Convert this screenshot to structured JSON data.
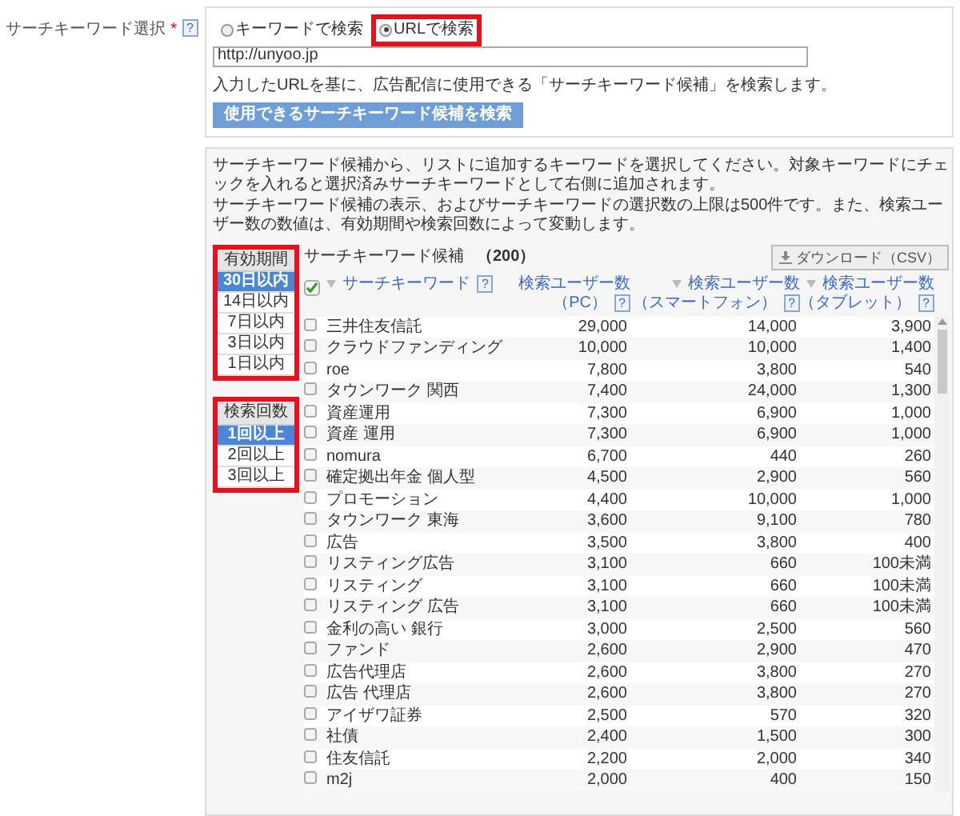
{
  "field": {
    "label": "サーチキーワード選択",
    "required": "*",
    "help": "?"
  },
  "search": {
    "modes": [
      {
        "label": "キーワードで検索",
        "selected": false,
        "highlighted": false
      },
      {
        "label": "URLで検索",
        "selected": true,
        "highlighted": true
      }
    ],
    "value": "http://unyoo.jp",
    "description": "入力したURLを基に、広告配信に使用できる「サーチキーワード候補」を検索します。",
    "button": "使用できるサーチキーワード候補を検索"
  },
  "instructions": [
    "サーチキーワード候補から、リストに追加するキーワードを選択してください。対象キーワードにチェックを入れると選択済みサーチキーワードとして右側に追加されます。",
    "サーチキーワード候補の表示、およびサーチキーワードの選択数の上限は500件です。また、検索ユーザー数の数値は、有効期間や検索回数によって変動します。"
  ],
  "filters": [
    {
      "title": "有効期間",
      "highlighted": true,
      "options": [
        {
          "label": "30日以内",
          "selected": true
        },
        {
          "label": "14日以内",
          "selected": false
        },
        {
          "label": "7日以内",
          "selected": false
        },
        {
          "label": "3日以内",
          "selected": false
        },
        {
          "label": "1日以内",
          "selected": false
        }
      ]
    },
    {
      "title": "検索回数",
      "highlighted": true,
      "options": [
        {
          "label": "1回以上",
          "selected": true
        },
        {
          "label": "2回以上",
          "selected": false
        },
        {
          "label": "3回以上",
          "selected": false
        }
      ]
    }
  ],
  "table": {
    "title": "サーチキーワード候補",
    "count": "（200）",
    "download": "ダウンロード（CSV）",
    "select_all_checked": true,
    "columns": [
      {
        "label": "サーチキーワード",
        "help": "?"
      },
      {
        "label": "検索ユーザー数",
        "sublabel": "（PC）",
        "help": "?"
      },
      {
        "label": "検索ユーザー数",
        "sublabel": "（スマートフォン）",
        "help": "?"
      },
      {
        "label": "検索ユーザー数",
        "sublabel": "（タブレット）",
        "help": "?"
      }
    ],
    "rows": [
      {
        "checked": false,
        "cells": [
          "三井住友信託",
          "29,000",
          "14,000",
          "3,900"
        ]
      },
      {
        "checked": false,
        "cells": [
          "クラウドファンディング",
          "10,000",
          "10,000",
          "1,400"
        ]
      },
      {
        "checked": false,
        "cells": [
          "roe",
          "7,800",
          "3,800",
          "540"
        ]
      },
      {
        "checked": false,
        "cells": [
          "タウンワーク 関西",
          "7,400",
          "24,000",
          "1,300"
        ]
      },
      {
        "checked": false,
        "cells": [
          "資産運用",
          "7,300",
          "6,900",
          "1,000"
        ]
      },
      {
        "checked": false,
        "cells": [
          "資産 運用",
          "7,300",
          "6,900",
          "1,000"
        ]
      },
      {
        "checked": false,
        "cells": [
          "nomura",
          "6,700",
          "440",
          "260"
        ]
      },
      {
        "checked": false,
        "cells": [
          "確定拠出年金 個人型",
          "4,500",
          "2,900",
          "560"
        ]
      },
      {
        "checked": false,
        "cells": [
          "プロモーション",
          "4,400",
          "10,000",
          "1,000"
        ]
      },
      {
        "checked": false,
        "cells": [
          "タウンワーク 東海",
          "3,600",
          "9,100",
          "780"
        ]
      },
      {
        "checked": false,
        "cells": [
          "広告",
          "3,500",
          "3,800",
          "400"
        ]
      },
      {
        "checked": false,
        "cells": [
          "リスティング広告",
          "3,100",
          "660",
          "100未満"
        ]
      },
      {
        "checked": false,
        "cells": [
          "リスティング",
          "3,100",
          "660",
          "100未満"
        ]
      },
      {
        "checked": false,
        "cells": [
          "リスティング 広告",
          "3,100",
          "660",
          "100未満"
        ]
      },
      {
        "checked": false,
        "cells": [
          "金利の高い 銀行",
          "3,000",
          "2,500",
          "560"
        ]
      },
      {
        "checked": false,
        "cells": [
          "ファンド",
          "2,600",
          "2,900",
          "470"
        ]
      },
      {
        "checked": false,
        "cells": [
          "広告代理店",
          "2,600",
          "3,800",
          "270"
        ]
      },
      {
        "checked": false,
        "cells": [
          "広告 代理店",
          "2,600",
          "3,800",
          "270"
        ]
      },
      {
        "checked": false,
        "cells": [
          "アイザワ証券",
          "2,500",
          "570",
          "320"
        ]
      },
      {
        "checked": false,
        "cells": [
          "社債",
          "2,400",
          "1,500",
          "300"
        ]
      },
      {
        "checked": false,
        "cells": [
          "住友信託",
          "2,200",
          "2,000",
          "340"
        ]
      },
      {
        "checked": false,
        "cells": [
          "m2j",
          "2,000",
          "400",
          "150"
        ]
      }
    ]
  }
}
